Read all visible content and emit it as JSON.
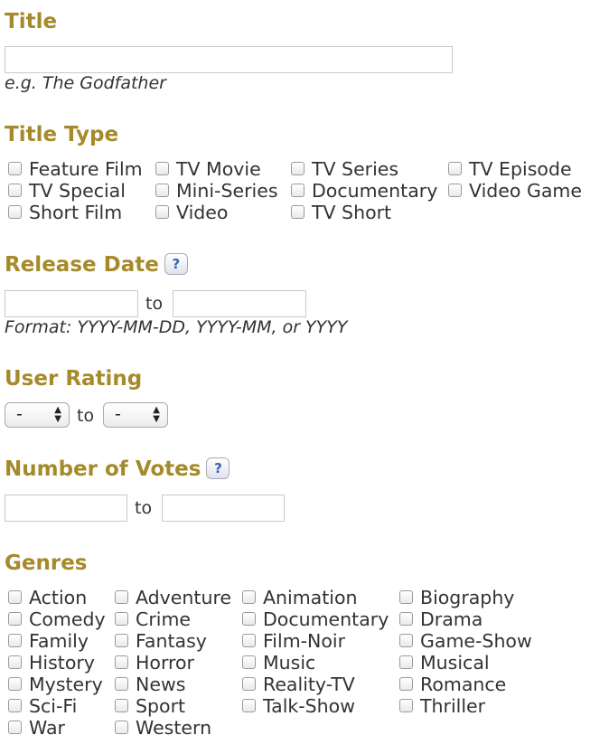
{
  "title_section": {
    "heading": "Title",
    "input_value": "",
    "hint": "e.g. The Godfather"
  },
  "title_type": {
    "heading": "Title Type",
    "options": [
      {
        "label": "Feature Film",
        "checked": false
      },
      {
        "label": "TV Movie",
        "checked": false
      },
      {
        "label": "TV Series",
        "checked": false
      },
      {
        "label": "TV Episode",
        "checked": false
      },
      {
        "label": "TV Special",
        "checked": false
      },
      {
        "label": "Mini-Series",
        "checked": false
      },
      {
        "label": "Documentary",
        "checked": false
      },
      {
        "label": "Video Game",
        "checked": false
      },
      {
        "label": "Short Film",
        "checked": false
      },
      {
        "label": "Video",
        "checked": false
      },
      {
        "label": "TV Short",
        "checked": false
      }
    ]
  },
  "release_date": {
    "heading": "Release Date",
    "help_glyph": "?",
    "from_value": "",
    "to_label": "to",
    "to_value": "",
    "hint": "Format: YYYY-MM-DD, YYYY-MM, or YYYY"
  },
  "user_rating": {
    "heading": "User Rating",
    "min_selected": "-",
    "to_label": "to",
    "max_selected": "-"
  },
  "votes": {
    "heading": "Number of Votes",
    "help_glyph": "?",
    "min_value": "",
    "to_label": "to",
    "max_value": ""
  },
  "genres": {
    "heading": "Genres",
    "options": [
      {
        "label": "Action",
        "checked": false
      },
      {
        "label": "Adventure",
        "checked": false
      },
      {
        "label": "Animation",
        "checked": false
      },
      {
        "label": "Biography",
        "checked": false
      },
      {
        "label": "Comedy",
        "checked": false
      },
      {
        "label": "Crime",
        "checked": false
      },
      {
        "label": "Documentary",
        "checked": false
      },
      {
        "label": "Drama",
        "checked": false
      },
      {
        "label": "Family",
        "checked": false
      },
      {
        "label": "Fantasy",
        "checked": false
      },
      {
        "label": "Film-Noir",
        "checked": false
      },
      {
        "label": "Game-Show",
        "checked": false
      },
      {
        "label": "History",
        "checked": false
      },
      {
        "label": "Horror",
        "checked": false
      },
      {
        "label": "Music",
        "checked": false
      },
      {
        "label": "Musical",
        "checked": false
      },
      {
        "label": "Mystery",
        "checked": false
      },
      {
        "label": "News",
        "checked": false
      },
      {
        "label": "Reality-TV",
        "checked": false
      },
      {
        "label": "Romance",
        "checked": false
      },
      {
        "label": "Sci-Fi",
        "checked": false
      },
      {
        "label": "Sport",
        "checked": false
      },
      {
        "label": "Talk-Show",
        "checked": false
      },
      {
        "label": "Thriller",
        "checked": false
      },
      {
        "label": "War",
        "checked": false
      },
      {
        "label": "Western",
        "checked": false
      }
    ]
  },
  "colors": {
    "heading": "#a58a2a",
    "help_icon": "#3a5fae"
  }
}
